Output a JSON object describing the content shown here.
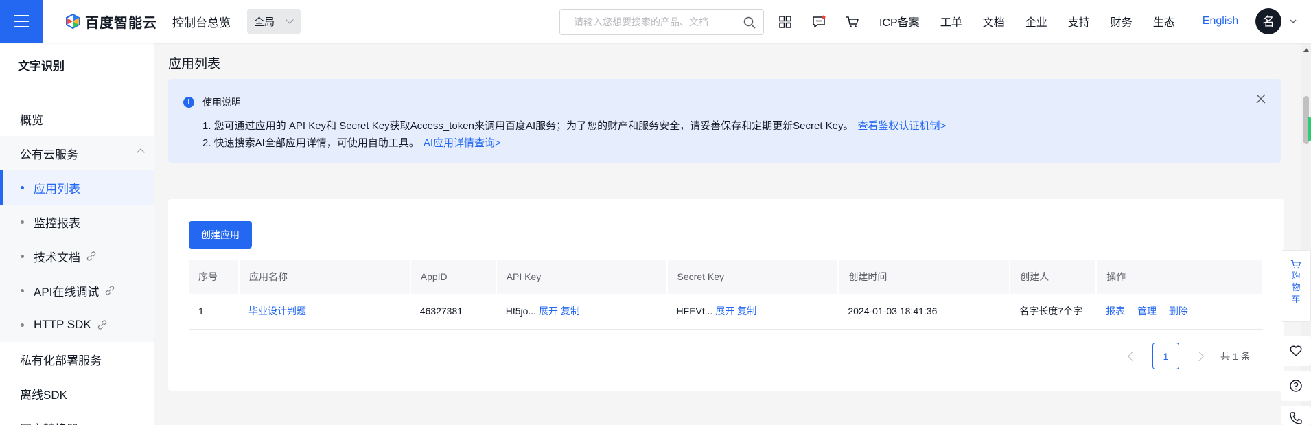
{
  "header": {
    "logo_text": "百度智能云",
    "console_home": "控制台总览",
    "scope": "全局",
    "search_placeholder": "请输入您想要搜索的产品、文档",
    "nav": [
      "ICP备案",
      "工单",
      "文档",
      "企业",
      "支持",
      "财务",
      "生态"
    ],
    "language": "English",
    "avatar_char": "名"
  },
  "sidebar": {
    "title": "文字识别",
    "overview": "概览",
    "public_cloud": "公有云服务",
    "sub_items": [
      "应用列表",
      "监控报表",
      "技术文档",
      "API在线调试",
      "HTTP SDK"
    ],
    "private_deploy": "私有化部署服务",
    "offline_sdk": "离线SDK",
    "image_convert": "图文转换器"
  },
  "main": {
    "page_title": "应用列表",
    "notice": {
      "title": "使用说明",
      "line1": "1. 您可通过应用的 API Key和 Secret Key获取Access_token来调用百度AI服务；为了您的财产和服务安全，请妥善保存和定期更新Secret Key。",
      "line1_link": "查看鉴权认证机制>",
      "line2": "2. 快速搜索AI全部应用详情，可使用自助工具。",
      "line2_link": "AI应用详情查询>"
    },
    "create_button": "创建应用",
    "table": {
      "headers": [
        "序号",
        "应用名称",
        "AppID",
        "API Key",
        "Secret Key",
        "创建时间",
        "创建人",
        "操作"
      ],
      "rows": [
        {
          "index": "1",
          "name": "毕业设计判题",
          "app_id": "46327381",
          "api_key_short": "Hf5jo...",
          "secret_key_short": "HFEVt...",
          "expand": "展开",
          "copy": "复制",
          "created_at": "2024-01-03 18:41:36",
          "creator": "名字长度7个字",
          "ops": [
            "报表",
            "管理",
            "删除"
          ]
        }
      ]
    },
    "pagination": {
      "current_page": "1",
      "total": "共 1 条"
    }
  },
  "float_tools": {
    "cart_label": [
      "购",
      "物",
      "车"
    ]
  },
  "colors": {
    "primary": "#2468f2",
    "notice_bg": "#e6eefd",
    "text": "#151b26"
  }
}
